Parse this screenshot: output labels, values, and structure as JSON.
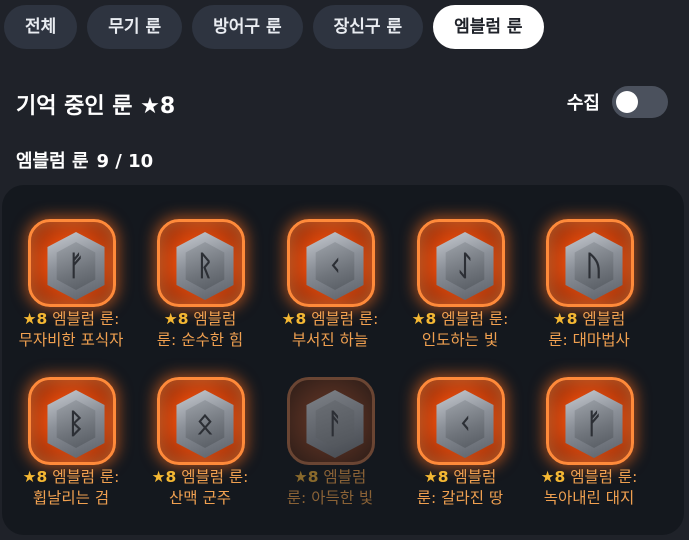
{
  "tabs": [
    {
      "label": "전체",
      "active": false
    },
    {
      "label": "무기 룬",
      "active": false
    },
    {
      "label": "방어구 룬",
      "active": false
    },
    {
      "label": "장신구 룬",
      "active": false
    },
    {
      "label": "엠블럼 룬",
      "active": true
    }
  ],
  "header": {
    "title": "기억 중인 룬 ★8",
    "collect_label": "수집",
    "collect_toggle_on": false
  },
  "section": {
    "label": "엠블럼 룬",
    "count": "9 / 10"
  },
  "colors": {
    "background": "#1f2229",
    "panel": "#14181e",
    "rune_name": "#f0a050",
    "star": "#f5b833",
    "frame_glow": "#ff7a22"
  },
  "runes": [
    {
      "star": "★8",
      "line1": "엠블럼 룬:",
      "line2": "무자비한 포식자",
      "glyph": "ᚠ",
      "icon": "rune-fehu-icon",
      "collected": true
    },
    {
      "star": "★8",
      "line1": "엠블럼",
      "line2": "룬: 순수한 힘",
      "glyph": "ᚱ",
      "icon": "rune-raido-icon",
      "collected": true
    },
    {
      "star": "★8",
      "line1": "엠블럼 룬:",
      "line2": "부서진 하늘",
      "glyph": "ᚲ",
      "icon": "rune-kenaz-icon",
      "collected": true
    },
    {
      "star": "★8",
      "line1": "엠블럼 룬:",
      "line2": "인도하는 빛",
      "glyph": "ᛇ",
      "icon": "rune-eihwaz-icon",
      "collected": true
    },
    {
      "star": "★8",
      "line1": "엠블럼",
      "line2": "룬: 대마법사",
      "glyph": "ᚢ",
      "icon": "rune-uruz-icon",
      "collected": true
    },
    {
      "star": "★8",
      "line1": "엠블럼 룬:",
      "line2": "휩날리는 검",
      "glyph": "ᛒ",
      "icon": "rune-berkano-icon",
      "collected": true
    },
    {
      "star": "★8",
      "line1": "엠블럼 룬:",
      "line2": "산맥 군주",
      "glyph": "ᛟ",
      "icon": "rune-othala-icon",
      "collected": true
    },
    {
      "star": "★8",
      "line1": "엠블럼",
      "line2": "룬: 아득한 빛",
      "glyph": "ᚨ",
      "icon": "rune-ansuz-icon",
      "collected": false
    },
    {
      "star": "★8",
      "line1": "엠블럼",
      "line2": "룬: 갈라진 땅",
      "glyph": "ᚲ",
      "icon": "rune-kaun-icon",
      "collected": true
    },
    {
      "star": "★8",
      "line1": "엠블럼 룬:",
      "line2": "녹아내린 대지",
      "glyph": "ᚠ",
      "icon": "rune-feoh-icon",
      "collected": true
    }
  ]
}
